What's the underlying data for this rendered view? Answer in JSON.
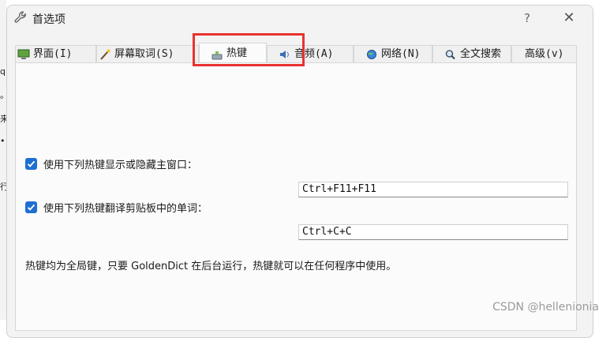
{
  "background": {
    "left_chars": [
      "q",
      "。",
      "来",
      "•",
      "行"
    ]
  },
  "dialog": {
    "title": "首选项",
    "help_label": "?",
    "close_label": "✕"
  },
  "tabs": [
    {
      "label": "界面(I)",
      "icon": "monitor-icon",
      "selected": false
    },
    {
      "label": "屏幕取词(S)",
      "icon": "wand-icon",
      "selected": false
    },
    {
      "label": "热键",
      "icon": "keyboard-icon",
      "selected": true
    },
    {
      "label": "音频(A)",
      "icon": "speaker-icon",
      "selected": false
    },
    {
      "label": "网络(N)",
      "icon": "globe-icon",
      "selected": false
    },
    {
      "label": "全文搜索",
      "icon": "search-icon",
      "selected": false
    },
    {
      "label": "高级(v)",
      "icon": "",
      "selected": false
    }
  ],
  "hotkeys": {
    "toggle_window": {
      "label": "使用下列热键显示或隐藏主窗口：",
      "checked": true,
      "value": "Ctrl+F11+F11"
    },
    "translate_clipboard": {
      "label": "使用下列热键翻译剪贴板中的单词：",
      "checked": true,
      "value": "Ctrl+C+C"
    },
    "note": "热键均为全局键，只要 GoldenDict 在后台运行，热键就可以在任何程序中使用。"
  },
  "colors": {
    "accent": "#1f6fd1",
    "highlight": "#e8332f"
  },
  "watermark": "CSDN @hellenionia"
}
